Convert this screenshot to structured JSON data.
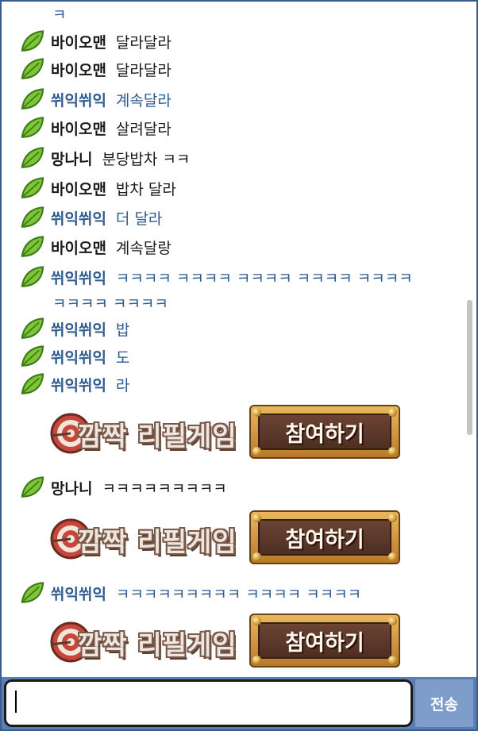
{
  "chat": {
    "top_continuation": "ㅋ",
    "messages": [
      {
        "nick": "바이오맨",
        "text": "달라달라",
        "color": "black"
      },
      {
        "nick": "바이오맨",
        "text": "달라달라",
        "color": "black"
      },
      {
        "nick": "쒸익쒸익",
        "text": "계속달라",
        "color": "blue"
      },
      {
        "nick": "바이오맨",
        "text": "살려달라",
        "color": "black"
      },
      {
        "nick": "망나니",
        "text": "분당밥차 ㅋㅋ",
        "color": "black"
      },
      {
        "nick": "바이오맨",
        "text": "밥차 달라",
        "color": "black"
      },
      {
        "nick": "쒸익쒸익",
        "text": "더 달라",
        "color": "blue"
      },
      {
        "nick": "바이오맨",
        "text": "계속달랑",
        "color": "black"
      },
      {
        "nick": "쒸익쒸익",
        "text": "ㅋㅋㅋㅋ ㅋㅋㅋㅋ ㅋㅋㅋㅋ ㅋㅋㅋㅋ ㅋㅋㅋㅋ",
        "color": "blue",
        "continuation": "ㅋㅋㅋㅋ ㅋㅋㅋㅋ"
      },
      {
        "nick": "쒸익쒸익",
        "text": "밥",
        "color": "blue"
      },
      {
        "nick": "쒸익쒸익",
        "text": "도",
        "color": "blue"
      },
      {
        "nick": "쒸익쒸익",
        "text": "라",
        "color": "blue"
      },
      {
        "nick": "망나니",
        "text": "ㅋㅋㅋㅋㅋㅋㅋㅋㅋ",
        "color": "black"
      },
      {
        "nick": "쒸익쒸익",
        "text": "ㅋㅋㅋㅋㅋㅋㅋㅋㅋ ㅋㅋㅋㅋ ㅋㅋㅋㅋ",
        "color": "blue"
      }
    ],
    "banner": {
      "title": "깜짝 리필게임",
      "button_label": "참여하기"
    }
  },
  "input": {
    "value": "",
    "send_label": "전송"
  },
  "colors": {
    "frame_border": "#3c5a8c",
    "nick_blue": "#2d5a8f",
    "input_bar": "#5a7db3",
    "send_button": "#7f9dcb"
  },
  "icons": [
    "leaf-icon",
    "target-icon"
  ]
}
